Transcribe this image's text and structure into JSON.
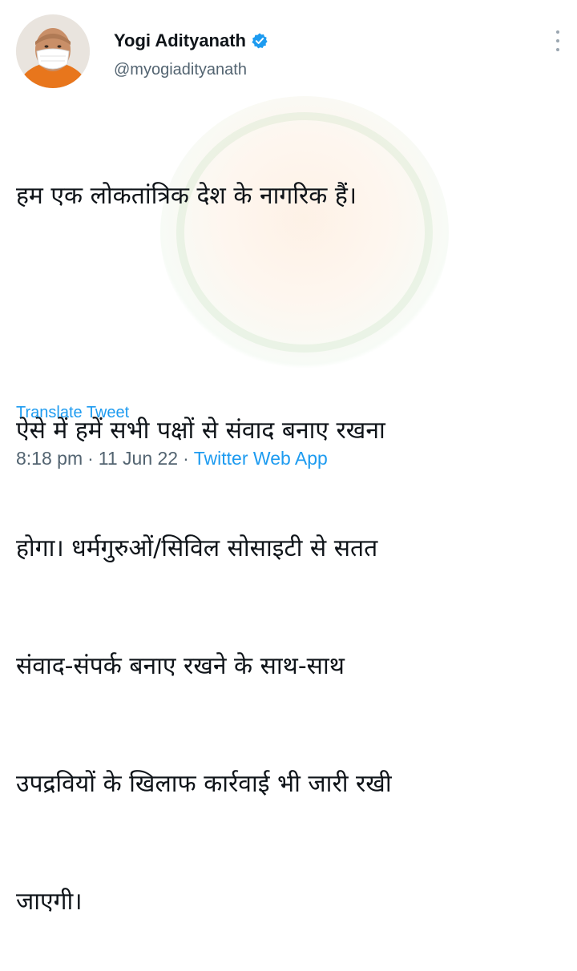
{
  "author": {
    "name": "Yogi Adityanath",
    "handle": "@myogiadityanath",
    "verified": true,
    "avatar_icon": "profile-photo-masked"
  },
  "tweet": {
    "line1": "हम एक लोकतांत्रिक देश के नागरिक हैं।",
    "line2": "ऐसे में हमें सभी पक्षों से संवाद बनाए रखना",
    "line3": "होगा। धर्मगुरुओं/सिविल सोसाइटी से सतत",
    "line4": "संवाद-संपर्क बनाए रखने के साथ-साथ",
    "line5": "उपद्रवियों के खिलाफ कार्रवाई भी जारी रखी",
    "line6": "जाएगी।"
  },
  "translate_label": "Translate Tweet",
  "meta": {
    "time": "8:18 pm",
    "date": "11 Jun 22",
    "source": "Twitter Web App",
    "separator": "·"
  },
  "colors": {
    "accent": "#1d9bf0",
    "secondary_text": "#536471",
    "primary_text": "#0f1419"
  }
}
